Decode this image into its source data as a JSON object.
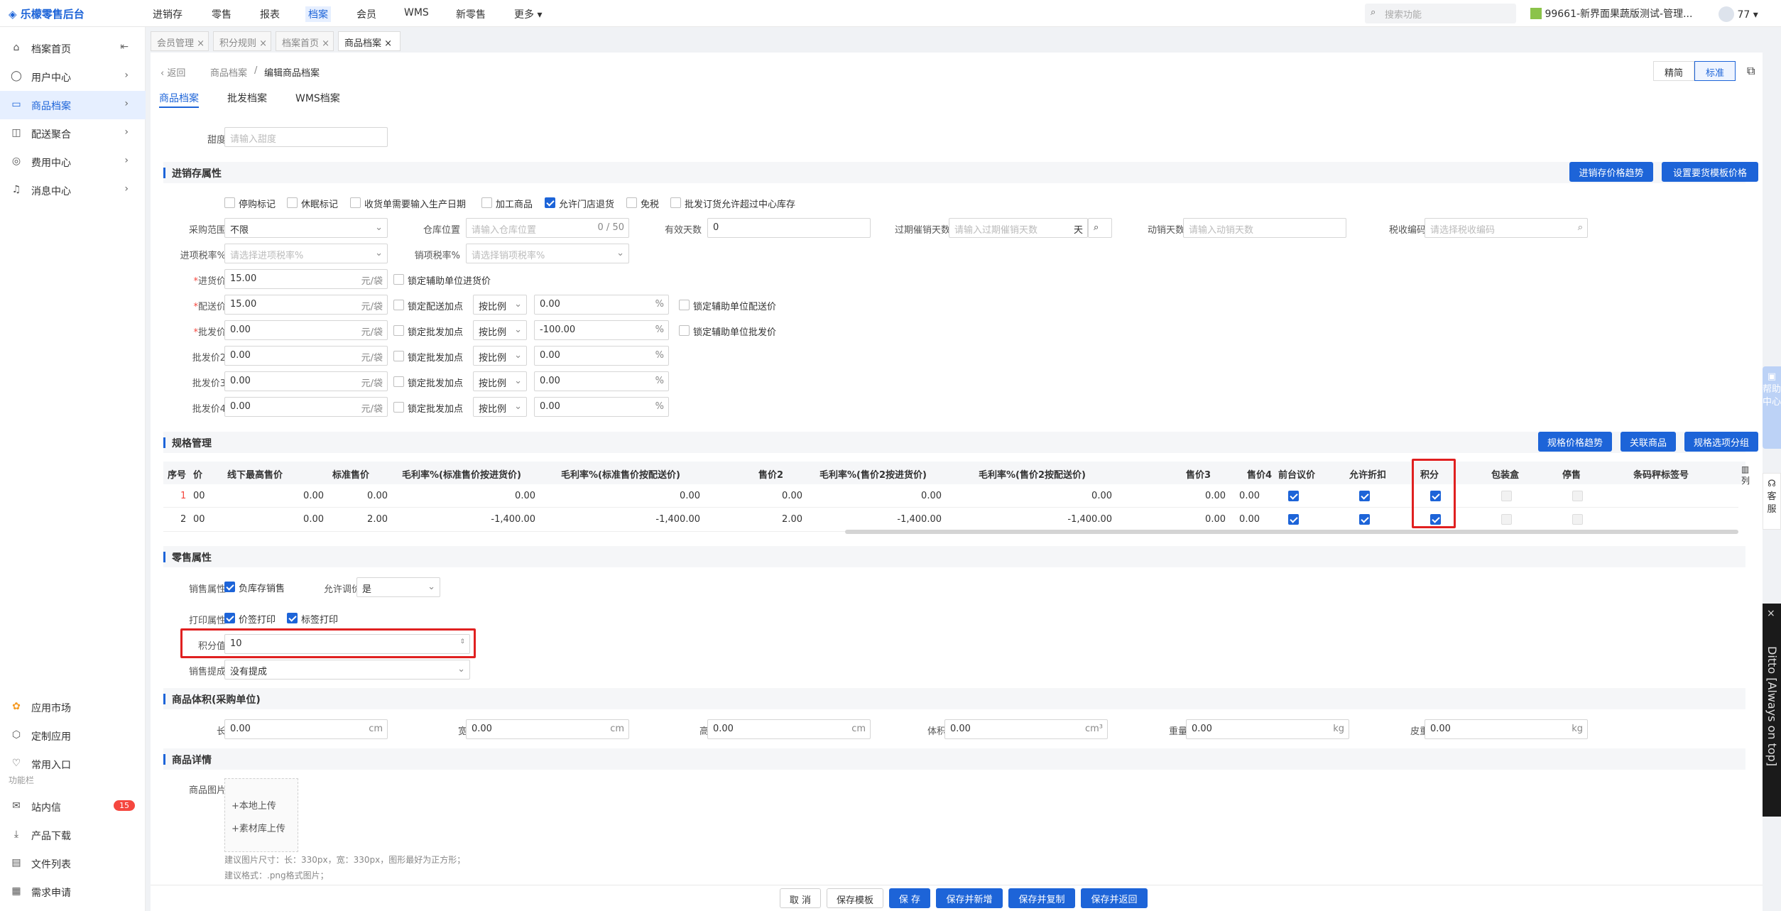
{
  "app": {
    "title": "乐檬零售后台",
    "search_placeholder": "搜索功能",
    "shop": "99661-新界面果蔬版测试-管理...",
    "user_count": "77"
  },
  "topnav": [
    "进销存",
    "零售",
    "报表",
    "档案",
    "会员",
    "WMS",
    "新零售",
    "更多"
  ],
  "sidebar": {
    "items": [
      "档案首页",
      "用户中心",
      "商品档案",
      "配送聚合",
      "费用中心",
      "消息中心"
    ],
    "bottom": [
      "应用市场",
      "定制应用",
      "常用入口"
    ],
    "section": "功能栏",
    "tools": [
      "站内信",
      "产品下载",
      "文件列表",
      "需求申请"
    ],
    "badge": "15"
  },
  "tabs": [
    "会员管理",
    "积分规则",
    "档案首页",
    "商品档案"
  ],
  "crumb": {
    "back": "返回",
    "parent": "商品档案",
    "sep": "/",
    "current": "编辑商品档案"
  },
  "view": {
    "simple": "精简",
    "standard": "标准"
  },
  "subtabs": [
    "商品档案",
    "批发档案",
    "WMS档案"
  ],
  "sweet": {
    "label": "甜度",
    "placeholder": "请输入甜度"
  },
  "inv": {
    "title": "进销存属性",
    "btn1": "进销存价格趋势",
    "btn2": "设置要货模板价格",
    "checks": [
      "停购标记",
      "休眠标记",
      "收货单需要输入生产日期",
      "加工商品",
      "允许门店退货",
      "免税",
      "批发订货允许超过中心库存"
    ],
    "range_label": "采购范围",
    "range_val": "不限",
    "loc_label": "仓库位置",
    "loc_ph": "请输入仓库位置",
    "loc_cnt": "0 / 50",
    "valid_label": "有效天数",
    "valid_val": "0",
    "expire_label": "过期催销天数",
    "expire_ph": "请输入过期催销天数",
    "expire_unit": "天",
    "move_label": "动销天数",
    "move_ph": "请输入动销天数",
    "tax_label": "税收编码",
    "tax_ph": "请选择税收编码",
    "in_tax_label": "进项税率%",
    "in_tax_ph": "请选择进项税率%",
    "out_tax_label": "销项税率%",
    "out_tax_ph": "请选择销项税率%",
    "purchase_label": "进货价",
    "purchase_val": "15.00",
    "unit": "元/袋",
    "lock_aux_purchase": "锁定辅助单位进货价",
    "dist_label": "配送价",
    "dist_val": "15.00",
    "lock_dist": "锁定配送加点",
    "mode": "按比例",
    "dist_pct": "0.00",
    "lock_aux_dist": "锁定辅助单位配送价",
    "whole_label": "批发价",
    "whole_val": "0.00",
    "lock_whole": "锁定批发加点",
    "whole_pct": "-100.00",
    "lock_aux_whole": "锁定辅助单位批发价",
    "w2_label": "批发价2",
    "w3_label": "批发价3",
    "w4_label": "批发价4",
    "zero": "0.00",
    "pct": "%"
  },
  "spec": {
    "title": "规格管理",
    "btn1": "规格价格趋势",
    "btn2": "关联商品",
    "btn3": "规格选项分组",
    "col": "列",
    "headers": [
      "序号",
      "价",
      "线下最高售价",
      "标准售价",
      "毛利率%(标准售价按进货价)",
      "毛利率%(标准售价按配送价)",
      "售价2",
      "毛利率%(售价2按进货价)",
      "毛利率%(售价2按配送价)",
      "售价3",
      "售价4",
      "前台议价",
      "允许折扣",
      "积分",
      "包装盒",
      "停售",
      "条码秤标签号"
    ],
    "rows": [
      [
        "1",
        "00",
        "0.00",
        "0.00",
        "0.00",
        "0.00",
        "0.00",
        "0.00",
        "0.00",
        "0.00",
        "0.00"
      ],
      [
        "2",
        "00",
        "0.00",
        "2.00",
        "-1,400.00",
        "-1,400.00",
        "2.00",
        "-1,400.00",
        "-1,400.00",
        "0.00",
        "0.00"
      ]
    ]
  },
  "retail": {
    "title": "零售属性",
    "sale_label": "销售属性",
    "neg": "负库存销售",
    "adj_label": "允许调价",
    "adj_val": "是",
    "print_label": "打印属性",
    "p1": "价签打印",
    "p2": "标签打印",
    "points_label": "积分值",
    "points_val": "10",
    "comm_label": "销售提成",
    "comm_val": "没有提成"
  },
  "vol": {
    "title": "商品体积(采购单位)",
    "l": "长",
    "w": "宽",
    "h": "高",
    "v": "体积",
    "wt": "重量",
    "tare": "皮重",
    "zero": "0.00",
    "cm": "cm",
    "cm3": "cm³",
    "kg": "kg"
  },
  "detail": {
    "title": "商品详情",
    "img_label": "商品图片",
    "local": "+本地上传",
    "lib": "+素材库上传",
    "hint1": "建议图片尺寸：长：330px，宽：330px，图形最好为正方形；",
    "hint2": "建议格式：.png格式图片；"
  },
  "footer": [
    "取 消",
    "保存模板",
    "保 存",
    "保存并新增",
    "保存并复制",
    "保存并返回"
  ],
  "float": {
    "help": "帮助中心",
    "service": "客服",
    "ditto": "Ditto [Always on top]"
  }
}
